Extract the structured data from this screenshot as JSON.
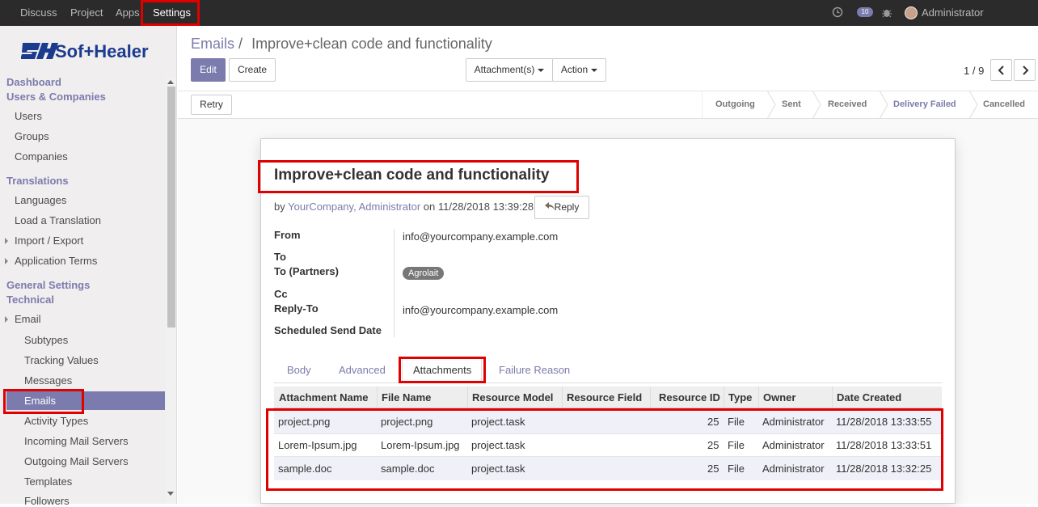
{
  "topbar": {
    "menu": [
      "Discuss",
      "Project",
      "Apps",
      "Settings"
    ],
    "messages_count": "10",
    "user": "Administrator (sh_email..."
  },
  "sidebar": {
    "logo_text": "Sof+Healer",
    "dashboard": "Dashboard",
    "users_companies": "Users & Companies",
    "users": "Users",
    "groups": "Groups",
    "companies": "Companies",
    "translations": "Translations",
    "languages": "Languages",
    "load_translation": "Load a Translation",
    "import_export": "Import / Export",
    "application_terms": "Application Terms",
    "general_settings": "General Settings",
    "technical": "Technical",
    "email": "Email",
    "subtypes": "Subtypes",
    "tracking_values": "Tracking Values",
    "messages": "Messages",
    "emails": "Emails",
    "activity_types": "Activity Types",
    "incoming_mail_servers": "Incoming Mail Servers",
    "outgoing_mail_servers": "Outgoing Mail Servers",
    "templates": "Templates",
    "followers": "Followers"
  },
  "breadcrumb": {
    "parent": "Emails",
    "sep": "/",
    "current": "Improve+clean code and functionality"
  },
  "buttons": {
    "edit": "Edit",
    "create": "Create",
    "attachments": "Attachment(s)",
    "action": "Action",
    "retry": "Retry",
    "reply": "Reply"
  },
  "pager": "1 / 9",
  "stages": [
    "Outgoing",
    "Sent",
    "Received",
    "Delivery Failed",
    "Cancelled"
  ],
  "email": {
    "subject": "Improve+clean code and functionality",
    "by": "by",
    "author": "YourCompany, Administrator",
    "on": "on 11/28/2018 13:39:28",
    "labels": {
      "from": "From",
      "to": "To",
      "to_partners": "To (Partners)",
      "cc": "Cc",
      "reply_to": "Reply-To",
      "scheduled": "Scheduled Send Date"
    },
    "from": "info@yourcompany.example.com",
    "partner_tag": "Agrolait",
    "reply_to": "info@yourcompany.example.com"
  },
  "tabs": [
    "Body",
    "Advanced",
    "Attachments",
    "Failure Reason"
  ],
  "table": {
    "headers": [
      "Attachment Name",
      "File Name",
      "Resource Model",
      "Resource Field",
      "Resource ID",
      "Type",
      "Owner",
      "Date Created"
    ],
    "rows": [
      [
        "project.png",
        "project.png",
        "project.task",
        "",
        "25",
        "File",
        "Administrator",
        "11/28/2018 13:33:55"
      ],
      [
        "Lorem-Ipsum.jpg",
        "Lorem-Ipsum.jpg",
        "project.task",
        "",
        "25",
        "File",
        "Administrator",
        "11/28/2018 13:33:51"
      ],
      [
        "sample.doc",
        "sample.doc",
        "project.task",
        "",
        "25",
        "File",
        "Administrator",
        "11/28/2018 13:32:25"
      ]
    ]
  },
  "colors": {
    "accent": "#7c7bad",
    "highlight": "#e00000",
    "topbar": "#2b2b2b"
  }
}
